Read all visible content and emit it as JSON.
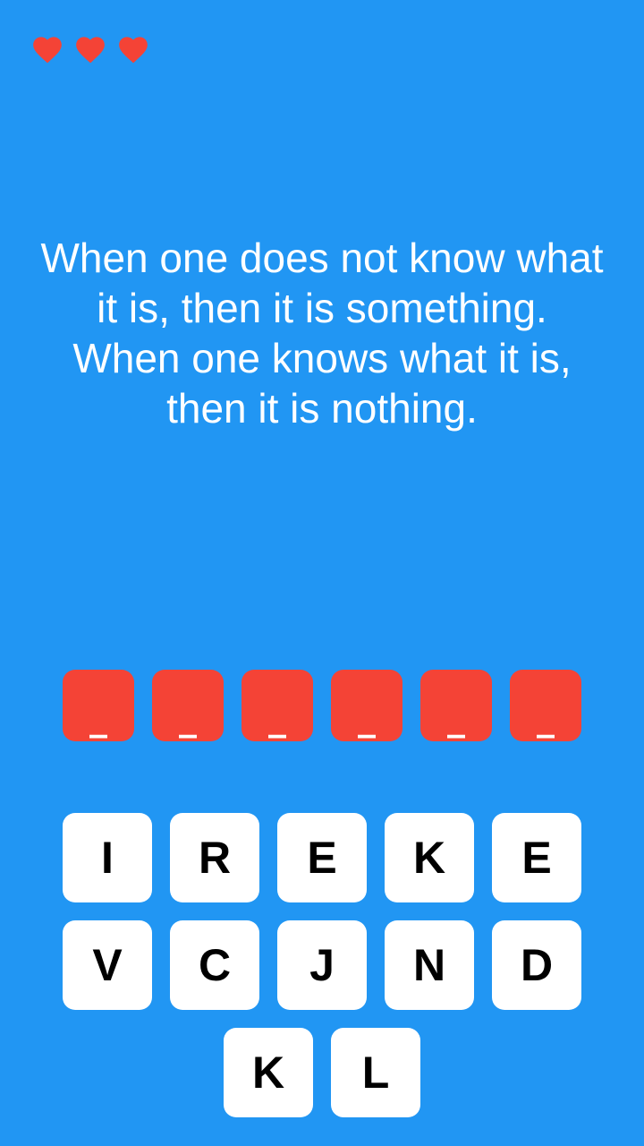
{
  "lives": {
    "count": 3,
    "icon": "heart-icon",
    "color": "#F44336"
  },
  "riddle": {
    "text": "When one does not know what\nit is, then it is something.\nWhen one knows what it is,\nthen it is nothing."
  },
  "answer": {
    "slots": [
      "_",
      "_",
      "_",
      "_",
      "_",
      "_"
    ],
    "slot_color": "#F44336"
  },
  "keyboard": {
    "rows": [
      [
        "I",
        "R",
        "E",
        "K",
        "E"
      ],
      [
        "V",
        "C",
        "J",
        "N",
        "D"
      ],
      [
        "K",
        "L"
      ]
    ]
  },
  "colors": {
    "background": "#2196F3",
    "key_background": "#FFFFFF",
    "key_text": "#000000"
  }
}
